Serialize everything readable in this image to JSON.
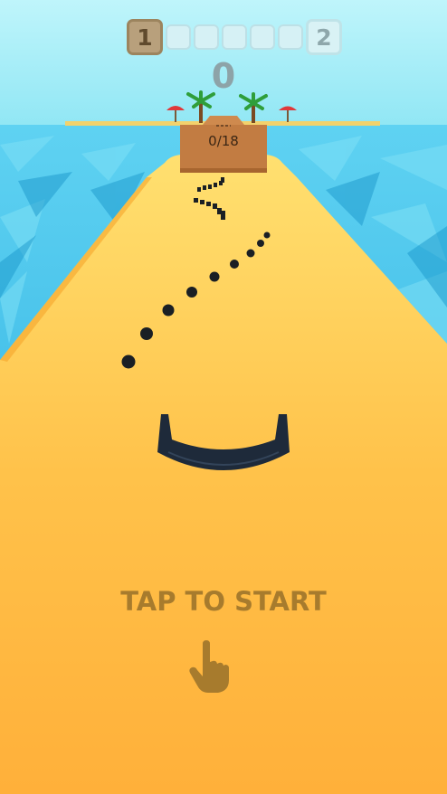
{
  "hud": {
    "current_level": "1",
    "next_level": "2",
    "progress_segments": 5,
    "progress_filled": 0,
    "score": "0"
  },
  "box": {
    "counter": "0/18"
  },
  "prompt": {
    "start_text": "TAP TO START",
    "icon": "tap-hand-icon"
  },
  "colors": {
    "sky": "#8fe6f4",
    "sea": "#2fb8e6",
    "track": "#ffb63d",
    "box": "#c07a40",
    "ball": "#1a1f24",
    "bowl": "#1e2a3a",
    "prompt_text": "#a77b2d"
  }
}
